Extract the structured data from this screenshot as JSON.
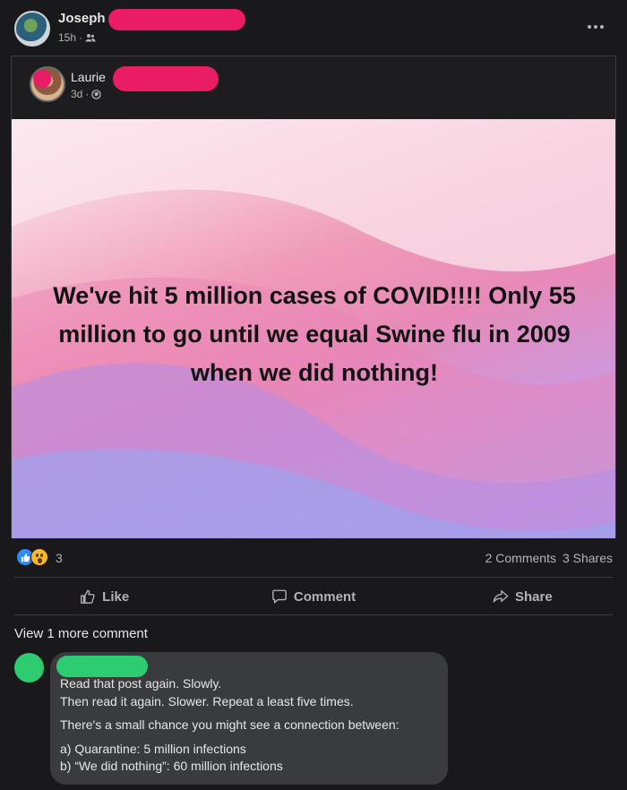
{
  "post": {
    "author": "Joseph",
    "time": "15h",
    "audience_icon": "friends-icon"
  },
  "shared": {
    "author": "Laurie",
    "time": "3d",
    "audience_icon": "globe-icon",
    "text": "We've hit 5 million cases of COVID!!!! Only 55 million to go until we equal Swine flu in 2009 when we did nothing!"
  },
  "reactions": {
    "icons": [
      "like-icon",
      "wow-icon"
    ],
    "count": "3",
    "comments": "2 Comments",
    "shares": "3 Shares"
  },
  "actions": {
    "like": "Like",
    "comment": "Comment",
    "share": "Share"
  },
  "comments": {
    "view_more": "View 1 more comment",
    "lines": [
      "Read that post again. Slowly.",
      "Then read it again. Slower. Repeat a least five times.",
      "There's a small chance you might see a connection between:",
      "a) Quarantine: 5 million infections",
      "b) “We did nothing”: 60 million infections"
    ]
  },
  "colors": {
    "background": "#19191b",
    "redaction_pink": "#ea1c66",
    "redaction_green": "#2ecc71",
    "bubble": "#3a3b3c"
  }
}
